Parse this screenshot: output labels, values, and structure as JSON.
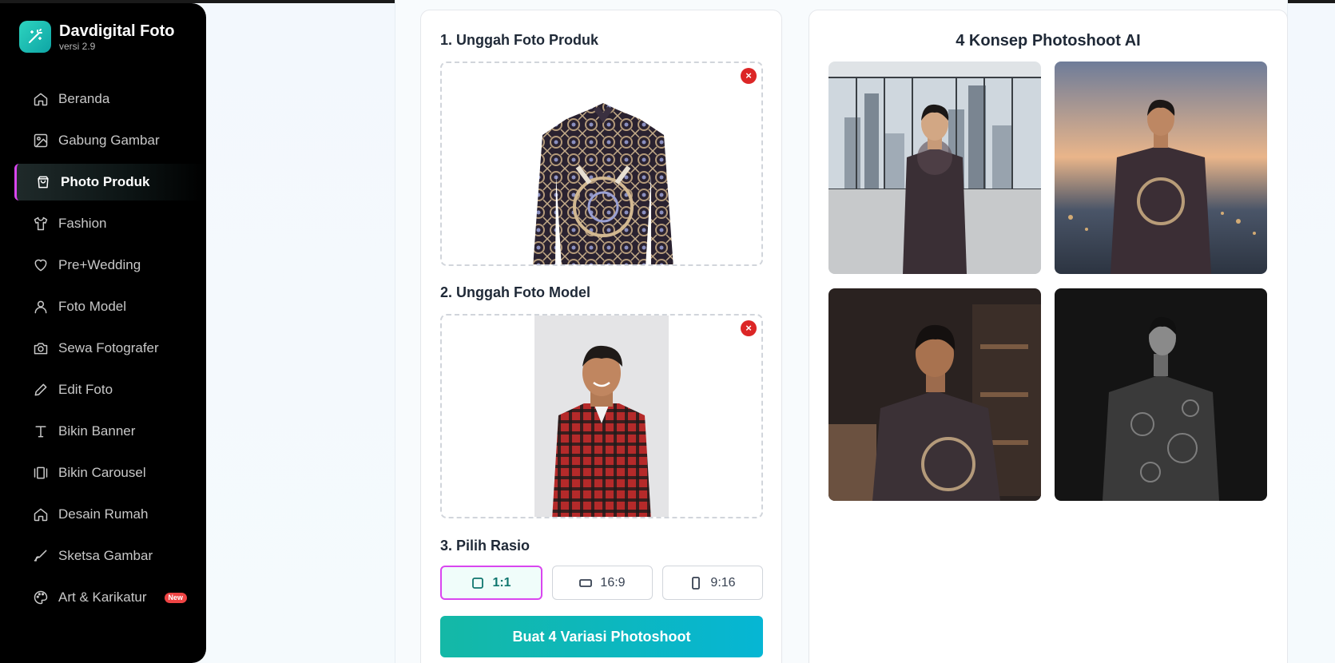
{
  "brand": {
    "title": "Davdigital Foto",
    "version": "versi 2.9"
  },
  "sidebar": {
    "items": [
      {
        "label": "Beranda",
        "icon": "home-icon"
      },
      {
        "label": "Gabung Gambar",
        "icon": "image-icon"
      },
      {
        "label": "Photo Produk",
        "icon": "shopping-bag-icon",
        "active": true
      },
      {
        "label": "Fashion",
        "icon": "shirt-icon"
      },
      {
        "label": "Pre+Wedding",
        "icon": "heart-icon"
      },
      {
        "label": "Foto Model",
        "icon": "user-icon"
      },
      {
        "label": "Sewa Fotografer",
        "icon": "camera-icon"
      },
      {
        "label": "Edit Foto",
        "icon": "pencil-icon"
      },
      {
        "label": "Bikin Banner",
        "icon": "type-icon"
      },
      {
        "label": "Bikin Carousel",
        "icon": "carousel-icon"
      },
      {
        "label": "Desain Rumah",
        "icon": "house-icon"
      },
      {
        "label": "Sketsa Gambar",
        "icon": "brush-icon"
      },
      {
        "label": "Art & Karikatur",
        "icon": "palette-icon",
        "badge": "New"
      }
    ]
  },
  "form": {
    "upload_product_title": "1. Unggah Foto Produk",
    "upload_model_title": "2. Unggah Foto Model",
    "ratio_title": "3. Pilih Rasio",
    "ratios": [
      {
        "label": "1:1",
        "selected": true
      },
      {
        "label": "16:9",
        "selected": false
      },
      {
        "label": "9:16",
        "selected": false
      }
    ],
    "submit_label": "Buat 4 Variasi Photoshoot",
    "remove_symbol": "×"
  },
  "results": {
    "title": "4 Konsep Photoshoot AI"
  },
  "colors": {
    "accent_teal": "#14b8a6",
    "accent_cyan": "#06b6d4",
    "active_border": "#d946ef",
    "danger": "#dc2626"
  }
}
